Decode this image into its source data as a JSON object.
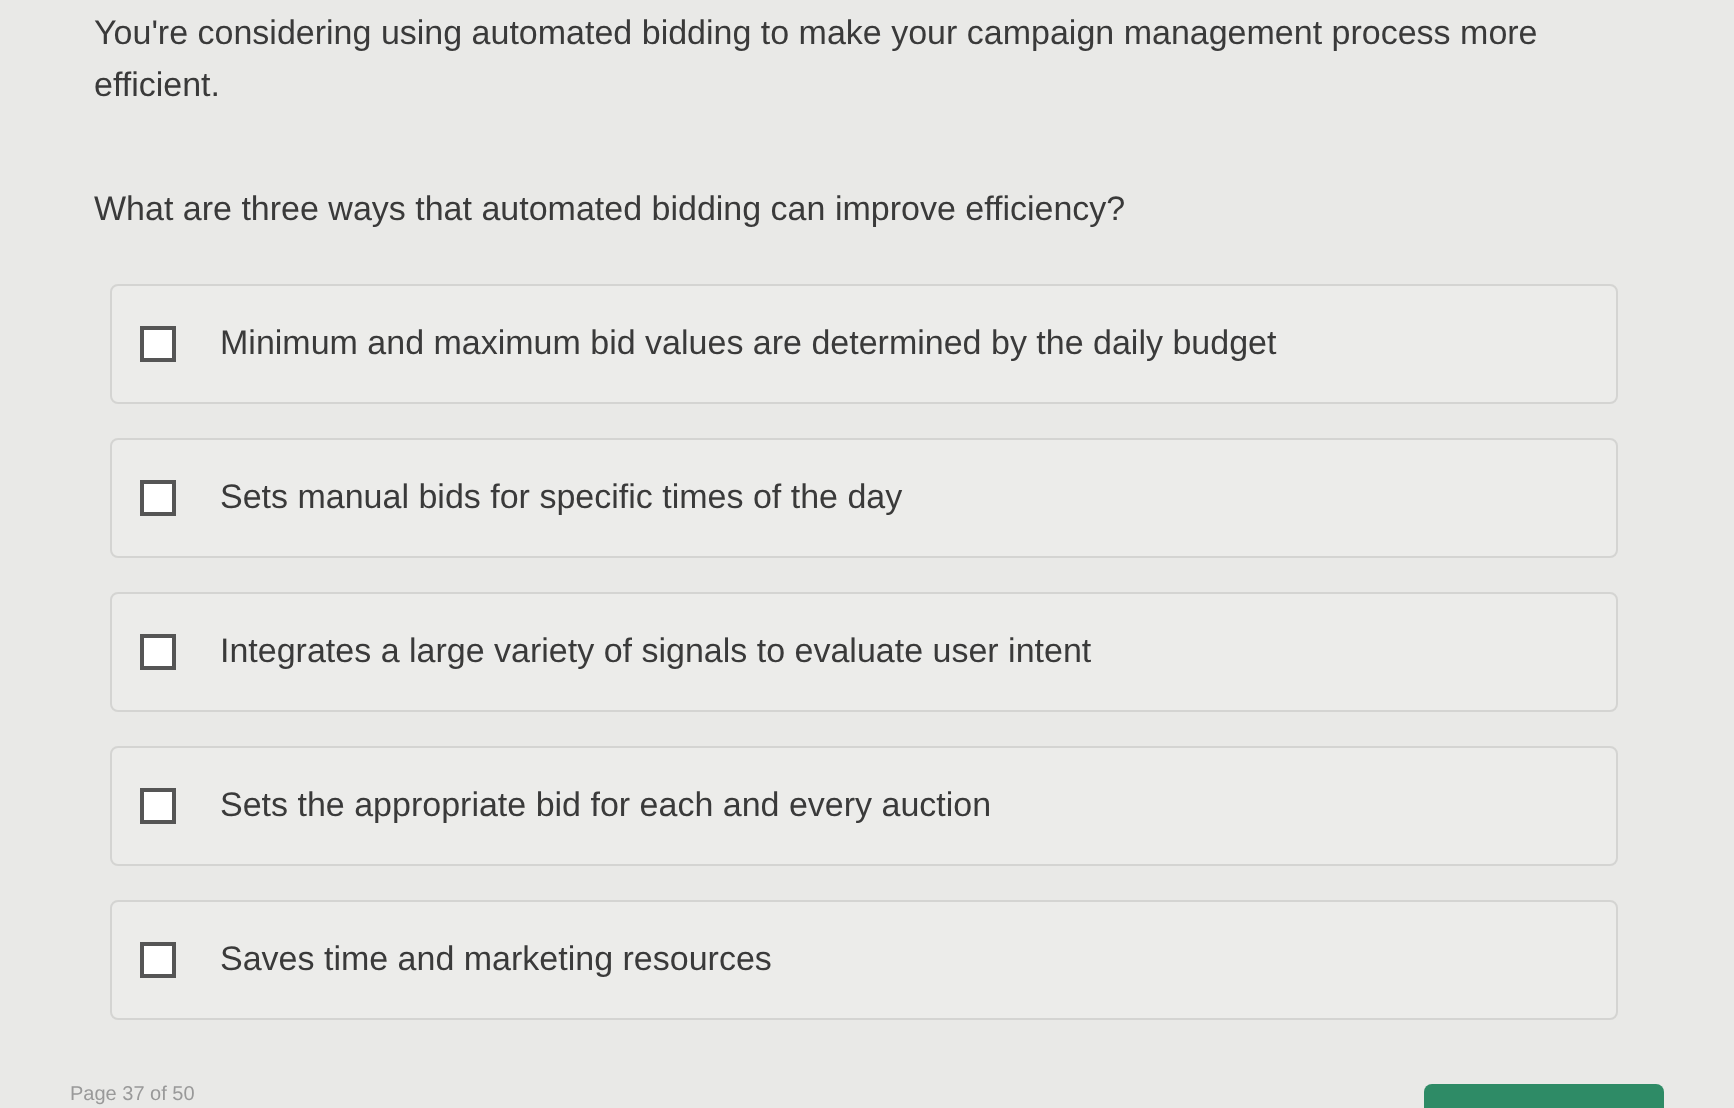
{
  "intro": "You're considering using automated bidding to make your campaign management process more efficient.",
  "question": "What are three ways that automated bidding can improve efficiency?",
  "options": [
    {
      "label": "Minimum and maximum bid values are determined by the daily budget",
      "checked": false
    },
    {
      "label": "Sets manual bids for specific times of the day",
      "checked": false
    },
    {
      "label": "Integrates a large variety of signals to evaluate user intent",
      "checked": false
    },
    {
      "label": "Sets the appropriate bid for each and every auction",
      "checked": false
    },
    {
      "label": "Saves time and marketing resources",
      "checked": false
    }
  ],
  "page_indicator": "Page 37 of 50"
}
